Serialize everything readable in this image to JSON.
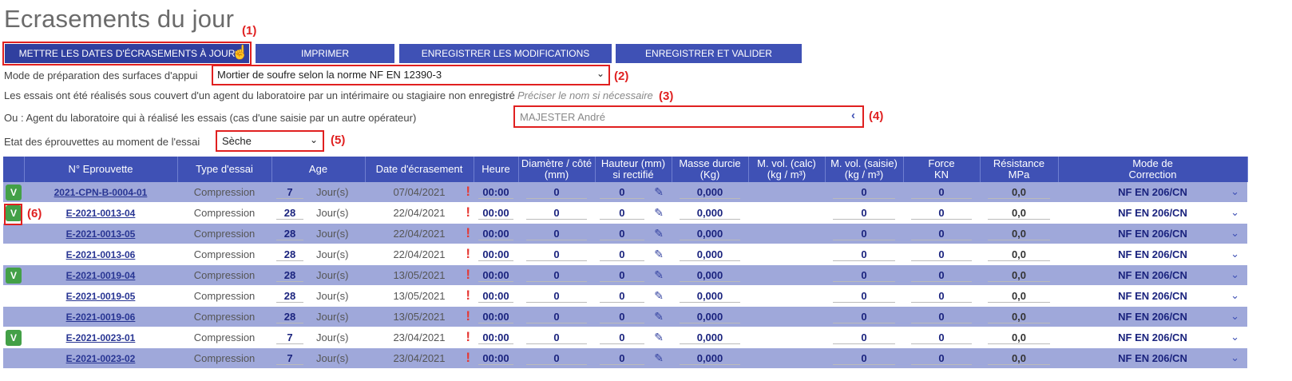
{
  "page": {
    "title": "Ecrasements du jour"
  },
  "toolbar": {
    "btn_update": "METTRE LES DATES D'ÉCRASEMENTS À JOUR",
    "btn_print": "IMPRIMER",
    "btn_save": "ENREGISTRER LES MODIFICATIONS",
    "btn_save_validate": "ENREGISTRER ET VALIDER"
  },
  "annotations": {
    "n1": "(1)",
    "n2": "(2)",
    "n3": "(3)",
    "n4": "(4)",
    "n5": "(5)",
    "n6": "(6)"
  },
  "form": {
    "prep_label": "Mode de préparation des surfaces d'appui",
    "prep_value": "Mortier de soufre selon la norme NF EN 12390-3",
    "interim_label": "Les essais ont été réalisés sous couvert d'un agent du laboratoire par un intérimaire ou stagiaire non enregistré",
    "interim_placeholder": "Préciser le nom si nécessaire",
    "agent_label": "Ou : Agent du laboratoire qui à réalisé les essais (cas d'une saisie par un autre opérateur)",
    "agent_value": "MAJESTER André",
    "state_label": "Etat des éprouvettes au moment de l'essai",
    "state_value": "Sèche"
  },
  "table": {
    "headers": {
      "num": "N° Eprouvette",
      "type": "Type d'essai",
      "age": "Age",
      "date": "Date d'écrasement",
      "heure": "Heure",
      "diam_l1": "Diamètre / côté",
      "diam_l2": "(mm)",
      "haut_l1": "Hauteur (mm)",
      "haut_l2": "si rectifié",
      "masse_l1": "Masse durcie",
      "masse_l2": "(Kg)",
      "mvc_l1": "M. vol. (calc)",
      "mvc_l2": "(kg / m³)",
      "mvs_l1": "M. vol. (saisie)",
      "mvs_l2": "(kg / m³)",
      "force_l1": "Force",
      "force_l2": "KN",
      "res_l1": "Résistance",
      "res_l2": "MPa",
      "mode_l1": "Mode de",
      "mode_l2": "Correction"
    },
    "rows": [
      {
        "v": "V",
        "num": "2021-CPN-B-0004-01",
        "type": "Compression",
        "age": "7",
        "unit": "Jour(s)",
        "date": "07/04/2021",
        "heure": "00:00",
        "diam": "0",
        "haut": "0",
        "masse": "0,000",
        "mvc": "",
        "mvs": "0",
        "force": "0",
        "res": "0,0",
        "mode": "NF EN 206/CN"
      },
      {
        "v": "V",
        "num": "E-2021-0013-04",
        "type": "Compression",
        "age": "28",
        "unit": "Jour(s)",
        "date": "22/04/2021",
        "heure": "00:00",
        "diam": "0",
        "haut": "0",
        "masse": "0,000",
        "mvc": "",
        "mvs": "0",
        "force": "0",
        "res": "0,0",
        "mode": "NF EN 206/CN"
      },
      {
        "v": "",
        "num": "E-2021-0013-05",
        "type": "Compression",
        "age": "28",
        "unit": "Jour(s)",
        "date": "22/04/2021",
        "heure": "00:00",
        "diam": "0",
        "haut": "0",
        "masse": "0,000",
        "mvc": "",
        "mvs": "0",
        "force": "0",
        "res": "0,0",
        "mode": "NF EN 206/CN"
      },
      {
        "v": "",
        "num": "E-2021-0013-06",
        "type": "Compression",
        "age": "28",
        "unit": "Jour(s)",
        "date": "22/04/2021",
        "heure": "00:00",
        "diam": "0",
        "haut": "0",
        "masse": "0,000",
        "mvc": "",
        "mvs": "0",
        "force": "0",
        "res": "0,0",
        "mode": "NF EN 206/CN"
      },
      {
        "v": "V",
        "num": "E-2021-0019-04",
        "type": "Compression",
        "age": "28",
        "unit": "Jour(s)",
        "date": "13/05/2021",
        "heure": "00:00",
        "diam": "0",
        "haut": "0",
        "masse": "0,000",
        "mvc": "",
        "mvs": "0",
        "force": "0",
        "res": "0,0",
        "mode": "NF EN 206/CN"
      },
      {
        "v": "",
        "num": "E-2021-0019-05",
        "type": "Compression",
        "age": "28",
        "unit": "Jour(s)",
        "date": "13/05/2021",
        "heure": "00:00",
        "diam": "0",
        "haut": "0",
        "masse": "0,000",
        "mvc": "",
        "mvs": "0",
        "force": "0",
        "res": "0,0",
        "mode": "NF EN 206/CN"
      },
      {
        "v": "",
        "num": "E-2021-0019-06",
        "type": "Compression",
        "age": "28",
        "unit": "Jour(s)",
        "date": "13/05/2021",
        "heure": "00:00",
        "diam": "0",
        "haut": "0",
        "masse": "0,000",
        "mvc": "",
        "mvs": "0",
        "force": "0",
        "res": "0,0",
        "mode": "NF EN 206/CN"
      },
      {
        "v": "V",
        "num": "E-2021-0023-01",
        "type": "Compression",
        "age": "7",
        "unit": "Jour(s)",
        "date": "23/04/2021",
        "heure": "00:00",
        "diam": "0",
        "haut": "0",
        "masse": "0,000",
        "mvc": "",
        "mvs": "0",
        "force": "0",
        "res": "0,0",
        "mode": "NF EN 206/CN"
      },
      {
        "v": "",
        "num": "E-2021-0023-02",
        "type": "Compression",
        "age": "7",
        "unit": "Jour(s)",
        "date": "23/04/2021",
        "heure": "00:00",
        "diam": "0",
        "haut": "0",
        "masse": "0,000",
        "mvc": "",
        "mvs": "0",
        "force": "0",
        "res": "0,0",
        "mode": "NF EN 206/CN"
      }
    ]
  },
  "colors": {
    "accent": "#3f51b5",
    "row_alt": "#9fa8da",
    "badge": "#43a047",
    "annotation": "#e02020"
  }
}
